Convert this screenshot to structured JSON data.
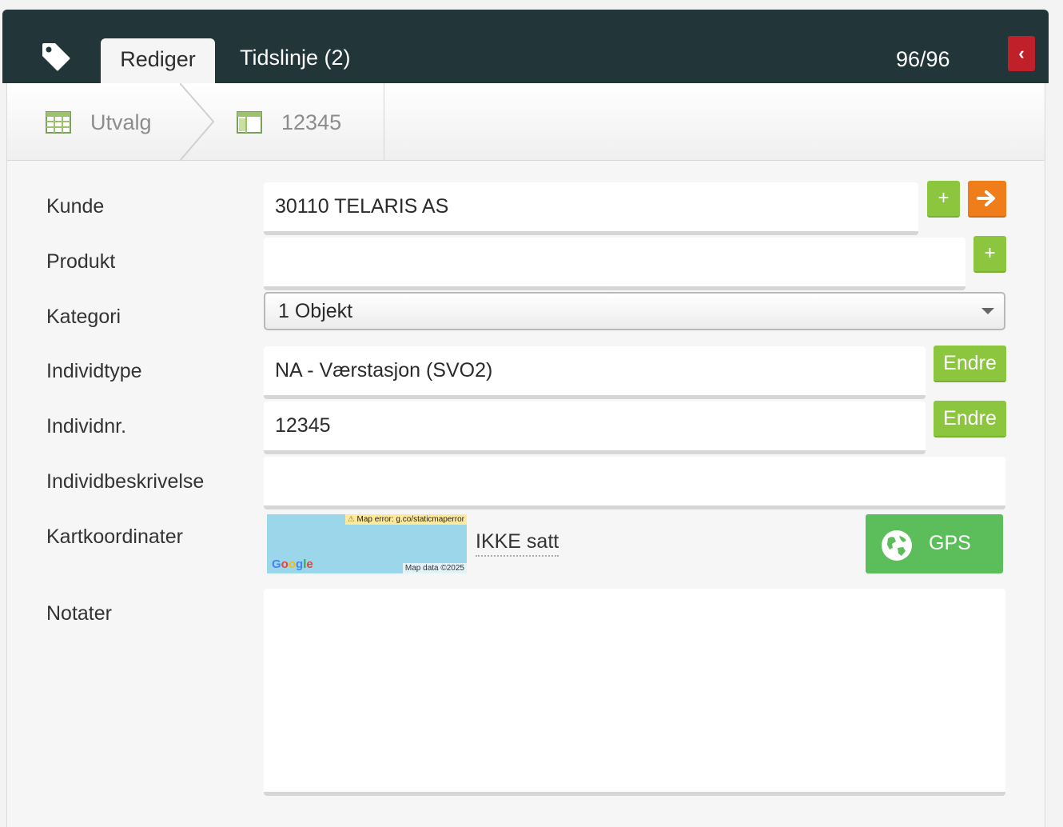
{
  "header": {
    "tabs": [
      {
        "label": "Rediger",
        "active": true
      },
      {
        "label": "Tidslinje (2)",
        "active": false
      }
    ],
    "record_counter": "96/96",
    "collapse_icon": "chevron-left-icon",
    "colors": {
      "bar": "#223538",
      "collapse": "#c0202a"
    }
  },
  "breadcrumb": {
    "items": [
      {
        "label": "Utvalg",
        "icon": "table-grid-icon"
      },
      {
        "label": "12345",
        "icon": "table-detail-icon"
      }
    ]
  },
  "form": {
    "kunde": {
      "label": "Kunde",
      "value": "30110 TELARIS AS",
      "add_label": "+",
      "goto_icon": "arrow-right-icon"
    },
    "produkt": {
      "label": "Produkt",
      "value": "",
      "add_label": "+"
    },
    "kategori": {
      "label": "Kategori",
      "value": "1 Objekt"
    },
    "individtype": {
      "label": "Individtype",
      "value": "NA - Værstasjon (SVO2)",
      "button_label": "Endre"
    },
    "individnr": {
      "label": "Individnr.",
      "value": "12345",
      "button_label": "Endre"
    },
    "individbeskrivelse": {
      "label": "Individbeskrivelse",
      "value": ""
    },
    "kartkoordinater": {
      "label": "Kartkoordinater",
      "map_error": "Map error: g.co/staticmaperror",
      "map_logo": "Google",
      "map_attribution": "Map data ©2025",
      "status": "IKKE satt",
      "gps_label": "GPS",
      "gps_icon": "globe-icon"
    },
    "notater": {
      "label": "Notater",
      "value": ""
    }
  },
  "colors": {
    "green_button": "#8cc63f",
    "orange_button": "#ef7d1a",
    "gps_button": "#5cbe5a"
  }
}
